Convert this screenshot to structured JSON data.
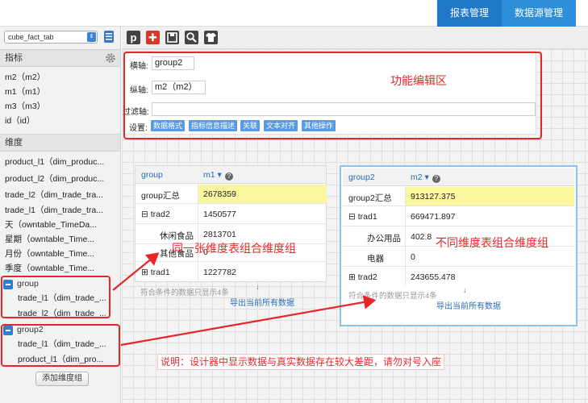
{
  "topnav": [
    "报表管理",
    "数据源管理"
  ],
  "sidebar": {
    "table_select": "cube_fact_tab",
    "indicators_title": "指标",
    "indicators": [
      "m2（m2）",
      "m1（m1）",
      "m3（m3）",
      "id（id）"
    ],
    "dimensions_title": "维度",
    "dimensions": [
      "product_l1（dim_produc...",
      "product_l2（dim_produc...",
      "trade_l2（dim_trade_tra...",
      "trade_l1（dim_trade_tra...",
      "天（owntable_TimeDa...",
      "星期（owntable_Time...",
      "月份（owntable_Time...",
      "季度（owntable_Time..."
    ],
    "groups": [
      {
        "name": "group",
        "items": [
          "trade_l1（dim_trade_...",
          "trade_l2（dim_trade_..."
        ]
      },
      {
        "name": "group2",
        "items": [
          "trade_l1（dim_trade_...",
          "product_l1（dim_pro..."
        ]
      }
    ],
    "add_group_label": "添加维度组"
  },
  "editor": {
    "x_label": "横轴:",
    "x_value": "group2",
    "y_label": "纵轴:",
    "y_value": "m2（m2）",
    "filter_label": "过滤轴:",
    "settings_label": "设置:",
    "settings_buttons": [
      "数据格式",
      "指标信息描述",
      "关联",
      "文本对齐",
      "其他操作"
    ]
  },
  "pivot1": {
    "header": [
      "group",
      "m1"
    ],
    "rows": [
      {
        "label": "group汇总",
        "value": "2678359"
      },
      {
        "label": "trad2",
        "value": "1450577"
      },
      {
        "label": "休闲食品",
        "value": "2813701"
      },
      {
        "label": "其他食品",
        "value": "0"
      },
      {
        "label": "trad1",
        "value": "1227782"
      }
    ],
    "footer_note": "符合条件的数据只显示4条",
    "export_label": "导出当前所有数据"
  },
  "pivot2": {
    "header": [
      "group2",
      "m2"
    ],
    "rows": [
      {
        "label": "group2汇总",
        "value": "913127.375"
      },
      {
        "label": "trad1",
        "value": "669471.897"
      },
      {
        "label": "办公用品",
        "value": "402.8"
      },
      {
        "label": "电器",
        "value": "0"
      },
      {
        "label": "trad2",
        "value": "243655.478"
      }
    ],
    "footer_note": "符合条件的数据只显示4条",
    "export_label": "导出当前所有数据"
  },
  "annotations": {
    "function_area": "功能编辑区",
    "same_table": "同一张维度表组合维度组",
    "diff_table": "不同维度表组合维度组",
    "note": "说明：设计器中显示数据与真实数据存在较大差距，请勿对号入座"
  },
  "colors": {
    "red": "#e8262a",
    "blue": "#2d8ed9",
    "highlight": "#fbf6a0"
  }
}
